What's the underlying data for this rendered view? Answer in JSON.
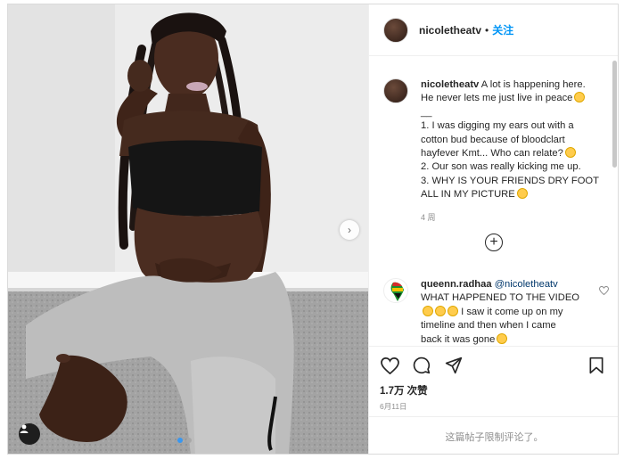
{
  "post": {
    "username": "nicoletheatv",
    "separator": "•",
    "follow_label": "关注"
  },
  "caption": {
    "username": "nicoletheatv",
    "lines": [
      "A lot is happening here.",
      "He never lets me just live in peace",
      "__",
      "1. I was digging my ears out with a",
      "cotton bud because of bloodclart",
      "hayfever Kmt... Who can relate?",
      "2. Our son was really kicking me up.",
      "3. WHY IS YOUR FRIENDS DRY FOOT",
      "ALL IN MY PICTURE"
    ],
    "time": "4 周"
  },
  "comment": {
    "username": "queenn.radhaa",
    "mention": "@nicoletheatv",
    "lines": [
      "WHAT HAPPENED TO THE VIDEO",
      "I saw it come up on my",
      "timeline and then when I came",
      "back it was gone"
    ]
  },
  "likes": "1.7万 次赞",
  "date": "6月11日",
  "comments_limited": "这篇帖子限制评论了。",
  "icons": {
    "like": "heart-icon",
    "comment": "comment-icon",
    "share": "paper-plane-icon",
    "save": "bookmark-icon",
    "more": "plus-circle-icon",
    "next": "chevron-right-icon",
    "tag": "user-tag-icon"
  },
  "colors": {
    "follow": "#0095f6",
    "carousel_active_dot": "#3897f0"
  },
  "carousel": {
    "slides": 2,
    "active": 1
  }
}
